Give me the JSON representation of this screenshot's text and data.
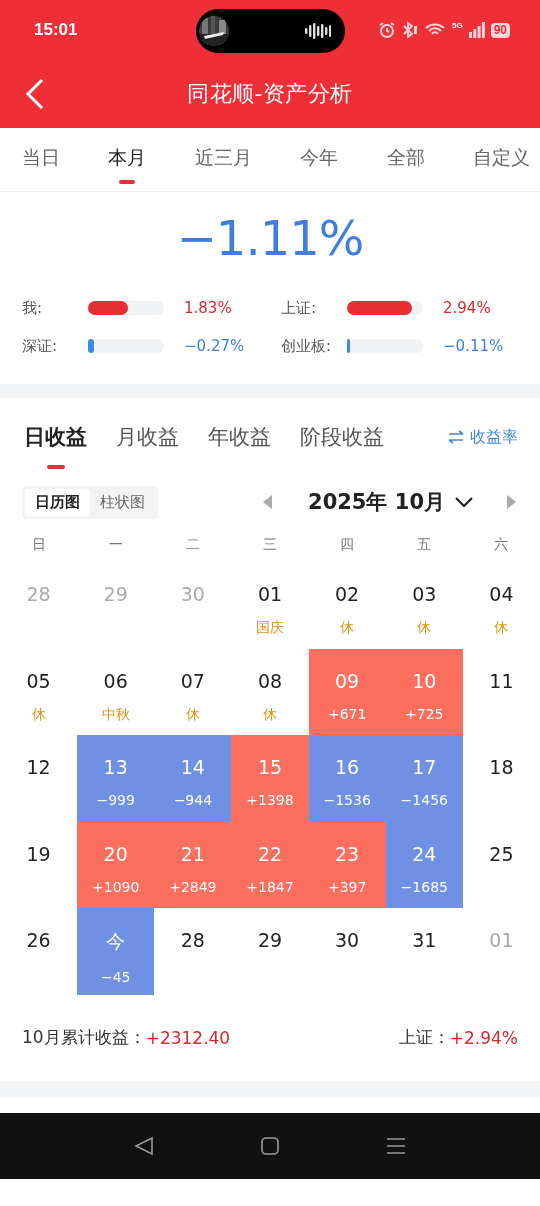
{
  "status_bar": {
    "time": "15:01",
    "network": "5G",
    "battery": "90"
  },
  "header": {
    "title": "同花顺-资产分析"
  },
  "period_tabs": [
    {
      "label": "当日",
      "selected": false
    },
    {
      "label": "本月",
      "selected": true
    },
    {
      "label": "近三月",
      "selected": false
    },
    {
      "label": "今年",
      "selected": false
    },
    {
      "label": "全部",
      "selected": false
    },
    {
      "label": "自定义",
      "selected": false
    }
  ],
  "summary": {
    "return": "−1.11%",
    "gain": false,
    "comparisons": [
      {
        "label": "我:",
        "level": 0.53,
        "value": "1.83%",
        "gain": true
      },
      {
        "label": "上证:",
        "level": 0.86,
        "value": "2.94%",
        "gain": true
      },
      {
        "label": "深证:",
        "level": 0.08,
        "value": "−0.27%",
        "gain": false
      },
      {
        "label": "创业板:",
        "level": 0.03,
        "value": "−0.11%",
        "gain": false
      }
    ]
  },
  "section_tabs": [
    {
      "label": "日收益",
      "selected": true
    },
    {
      "label": "月收益",
      "selected": false
    },
    {
      "label": "年收益",
      "selected": false
    },
    {
      "label": "阶段收益",
      "selected": false
    }
  ],
  "rate_toggle": {
    "label": "收益率"
  },
  "view_toggle": [
    {
      "label": "日历图",
      "selected": true
    },
    {
      "label": "柱状图",
      "selected": false
    }
  ],
  "month_picker": {
    "label": "2025年 10月"
  },
  "weekdays": [
    "日",
    "一",
    "二",
    "三",
    "四",
    "五",
    "六"
  ],
  "calendar": [
    [
      {
        "day": "28",
        "kind": "other"
      },
      {
        "day": "29",
        "kind": "other"
      },
      {
        "day": "30",
        "kind": "other"
      },
      {
        "day": "01",
        "note": "国庆",
        "kind": "holiday"
      },
      {
        "day": "02",
        "note": "休",
        "kind": "holiday"
      },
      {
        "day": "03",
        "note": "休",
        "kind": "holiday"
      },
      {
        "day": "04",
        "note": "休",
        "kind": "holiday"
      }
    ],
    [
      {
        "day": "05",
        "note": "休",
        "kind": "holiday"
      },
      {
        "day": "06",
        "note": "中秋",
        "kind": "holiday"
      },
      {
        "day": "07",
        "note": "休",
        "kind": "holiday"
      },
      {
        "day": "08",
        "note": "休",
        "kind": "holiday"
      },
      {
        "day": "09",
        "note": "+671",
        "kind": "gain"
      },
      {
        "day": "10",
        "note": "+725",
        "kind": "gain"
      },
      {
        "day": "11",
        "kind": "normal"
      }
    ],
    [
      {
        "day": "12",
        "kind": "normal"
      },
      {
        "day": "13",
        "note": "−999",
        "kind": "loss"
      },
      {
        "day": "14",
        "note": "−944",
        "kind": "loss"
      },
      {
        "day": "15",
        "note": "+1398",
        "kind": "gain"
      },
      {
        "day": "16",
        "note": "−1536",
        "kind": "loss"
      },
      {
        "day": "17",
        "note": "−1456",
        "kind": "loss"
      },
      {
        "day": "18",
        "kind": "normal"
      }
    ],
    [
      {
        "day": "19",
        "kind": "normal"
      },
      {
        "day": "20",
        "note": "+1090",
        "kind": "gain"
      },
      {
        "day": "21",
        "note": "+2849",
        "kind": "gain"
      },
      {
        "day": "22",
        "note": "+1847",
        "kind": "gain"
      },
      {
        "day": "23",
        "note": "+397",
        "kind": "gain"
      },
      {
        "day": "24",
        "note": "−1685",
        "kind": "loss"
      },
      {
        "day": "25",
        "kind": "normal"
      }
    ],
    [
      {
        "day": "26",
        "kind": "normal"
      },
      {
        "day": "今",
        "note": "−45",
        "kind": "loss"
      },
      {
        "day": "28",
        "kind": "normal"
      },
      {
        "day": "29",
        "kind": "normal"
      },
      {
        "day": "30",
        "kind": "normal"
      },
      {
        "day": "31",
        "kind": "normal"
      },
      {
        "day": "01",
        "kind": "other"
      }
    ]
  ],
  "footer": {
    "label": "10月累计收益：",
    "value": "+2312.40",
    "value_gain": true,
    "index_label": "上证：",
    "index_value": "+2.94%",
    "index_gain": true
  }
}
